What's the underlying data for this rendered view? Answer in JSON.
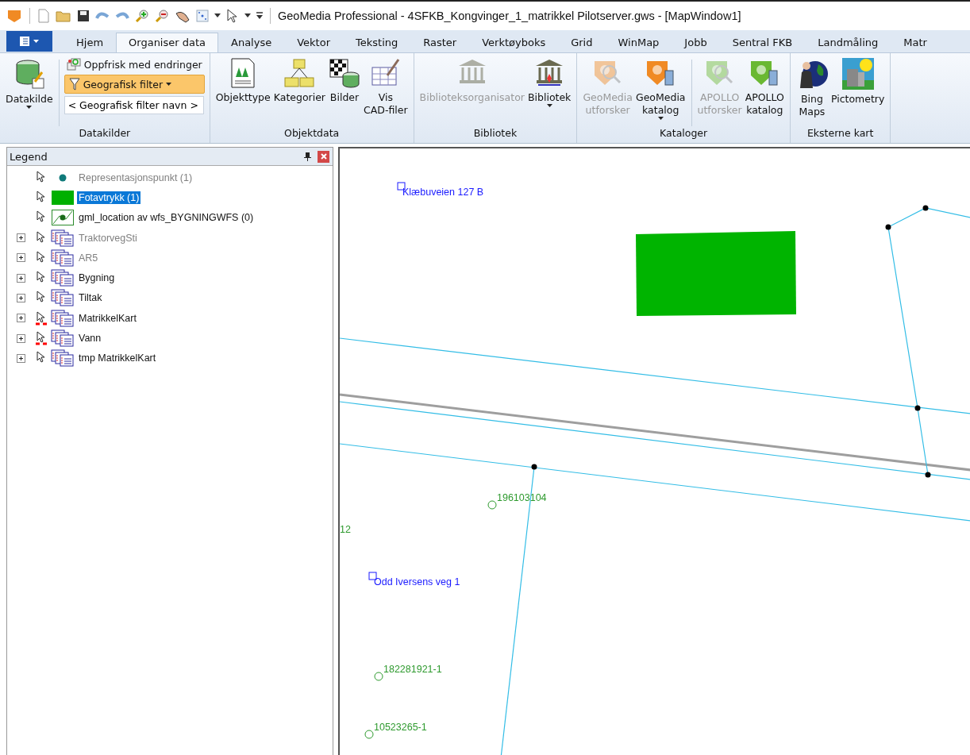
{
  "window": {
    "title": "GeoMedia Professional - 4SFKB_Kongvinger_1_matrikkel Pilotserver.gws - [MapWindow1]"
  },
  "tabs": [
    {
      "label": "Hjem",
      "selected": false
    },
    {
      "label": "Organiser data",
      "selected": true
    },
    {
      "label": "Analyse",
      "selected": false
    },
    {
      "label": "Vektor",
      "selected": false
    },
    {
      "label": "Teksting",
      "selected": false
    },
    {
      "label": "Raster",
      "selected": false
    },
    {
      "label": "Verktøyboks",
      "selected": false
    },
    {
      "label": "Grid",
      "selected": false
    },
    {
      "label": "WinMap",
      "selected": false
    },
    {
      "label": "Jobb",
      "selected": false
    },
    {
      "label": "Sentral FKB",
      "selected": false
    },
    {
      "label": "Landmåling",
      "selected": false
    },
    {
      "label": "Matr",
      "selected": false
    }
  ],
  "ribbon": {
    "datasource": {
      "title": "Datakilder",
      "button": {
        "label": "Datakilde",
        "dropdown": true
      },
      "refresh": {
        "label": "Oppfrisk med endringer"
      },
      "filter": {
        "label": "Geografisk filter",
        "active": true
      },
      "filter_name": {
        "value": "< Geografisk filter navn >"
      }
    },
    "groups": [
      {
        "title": "Objektdata",
        "buttons": [
          {
            "lines": [
              "Objekttype"
            ],
            "disabled": false,
            "dropdown": false
          },
          {
            "lines": [
              "Kategorier"
            ],
            "disabled": false,
            "dropdown": false
          },
          {
            "lines": [
              "Bilder"
            ],
            "disabled": false,
            "dropdown": false
          },
          {
            "lines": [
              "Vis",
              "CAD-filer"
            ],
            "disabled": false,
            "dropdown": false
          }
        ]
      },
      {
        "title": "Bibliotek",
        "buttons": [
          {
            "lines": [
              "Biblioteksorganisator"
            ],
            "disabled": true,
            "dropdown": false
          },
          {
            "lines": [
              "Bibliotek"
            ],
            "disabled": false,
            "dropdown": true
          }
        ]
      },
      {
        "title": "Kataloger",
        "buttons": [
          {
            "lines": [
              "GeoMedia",
              "utforsker"
            ],
            "disabled": true,
            "dropdown": false
          },
          {
            "lines": [
              "GeoMedia",
              "katalog"
            ],
            "disabled": false,
            "dropdown": true
          },
          {
            "lines": [
              "APOLLO",
              "utforsker"
            ],
            "disabled": true,
            "dropdown": false
          },
          {
            "lines": [
              "APOLLO",
              "katalog"
            ],
            "disabled": false,
            "dropdown": false
          }
        ]
      },
      {
        "title": "Eksterne kart",
        "buttons": [
          {
            "lines": [
              "Bing",
              "Maps"
            ],
            "disabled": false,
            "dropdown": false
          },
          {
            "lines": [
              "Pictometry"
            ],
            "disabled": false,
            "dropdown": false
          }
        ]
      }
    ]
  },
  "legend": {
    "title": "Legend",
    "items": [
      {
        "kind": "point",
        "label": "Representasjonspunkt (1)",
        "disabled": true,
        "selected": false,
        "flagged": false
      },
      {
        "kind": "area",
        "label": "Fotavtrykk (1)",
        "disabled": false,
        "selected": true,
        "flagged": false
      },
      {
        "kind": "line",
        "label": "gml_location av wfs_BYGNINGWFS (0)",
        "disabled": false,
        "selected": false,
        "flagged": false
      },
      {
        "kind": "group",
        "label": "TraktorvegSti",
        "disabled": true,
        "selected": false,
        "flagged": false
      },
      {
        "kind": "group",
        "label": "AR5",
        "disabled": true,
        "selected": false,
        "flagged": false
      },
      {
        "kind": "group",
        "label": "Bygning",
        "disabled": false,
        "selected": false,
        "flagged": false
      },
      {
        "kind": "group",
        "label": "Tiltak",
        "disabled": false,
        "selected": false,
        "flagged": false
      },
      {
        "kind": "group",
        "label": "MatrikkelKart",
        "disabled": false,
        "selected": false,
        "flagged": true
      },
      {
        "kind": "group",
        "label": "Vann",
        "disabled": false,
        "selected": false,
        "flagged": true
      },
      {
        "kind": "group",
        "label": "tmp MatrikkelKart",
        "disabled": false,
        "selected": false,
        "flagged": false
      }
    ]
  },
  "map": {
    "labels": [
      {
        "kind": "address",
        "text": "Klæbuveien 127 B"
      },
      {
        "kind": "parcel",
        "text": "196103104"
      },
      {
        "kind": "plain",
        "text": "12"
      },
      {
        "kind": "address",
        "text": "Odd Iversens veg 1"
      },
      {
        "kind": "parcel",
        "text": "182281921-1"
      },
      {
        "kind": "parcel",
        "text": "10523265-1"
      }
    ]
  }
}
